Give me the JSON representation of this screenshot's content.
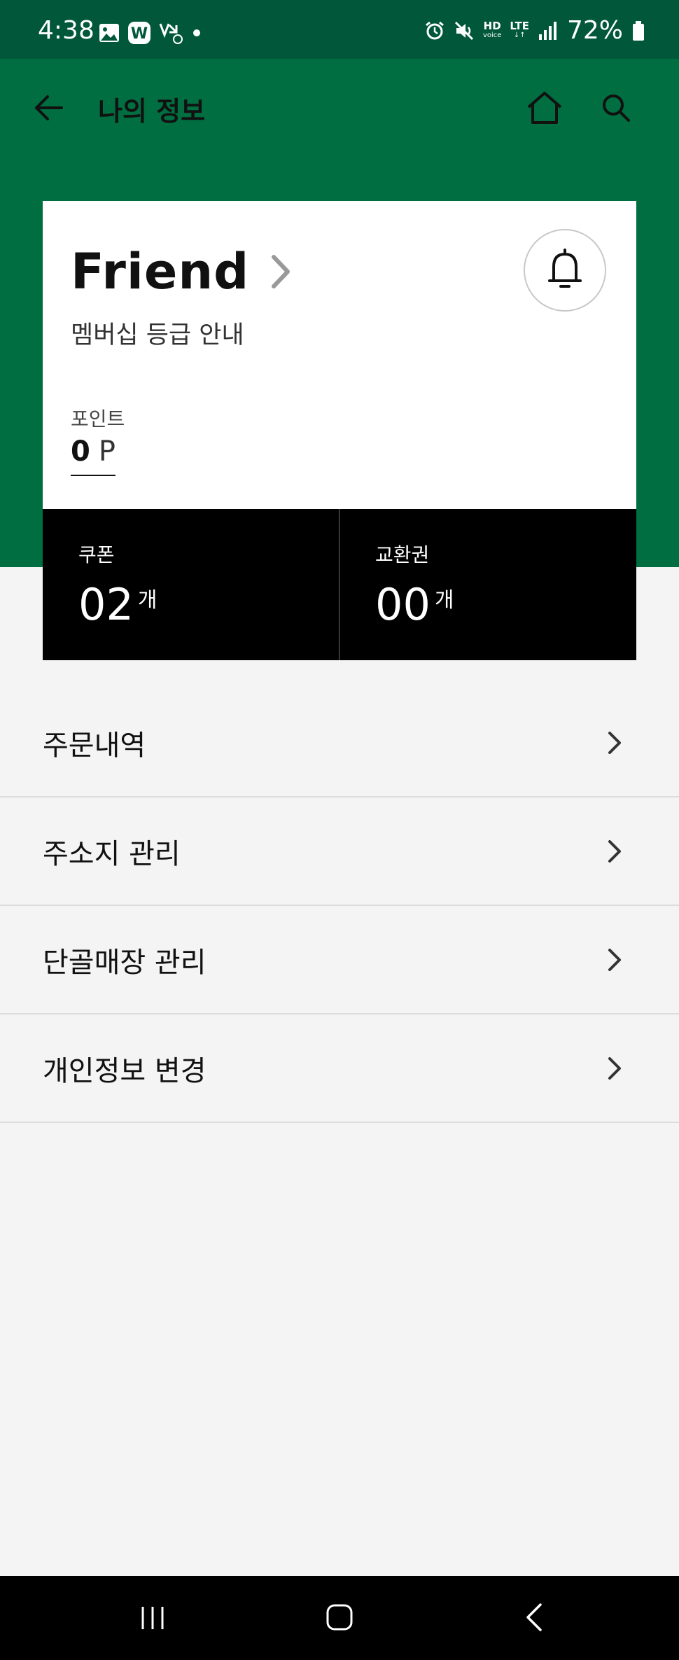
{
  "status_bar": {
    "time": "4:38",
    "battery": "72%",
    "hd_label": "HD",
    "hd_sub": "voice",
    "lte_label": "LTE"
  },
  "app_bar": {
    "title": "나의 정보"
  },
  "membership": {
    "tier": "Friend",
    "guide_label": "멤버십 등급 안내",
    "points_label": "포인트",
    "points_value": "0",
    "points_unit": "P"
  },
  "stats": {
    "coupon_label": "쿠폰",
    "coupon_value": "02",
    "coupon_unit": "개",
    "voucher_label": "교환권",
    "voucher_value": "00",
    "voucher_unit": "개"
  },
  "menu": {
    "items": [
      {
        "label": "주문내역"
      },
      {
        "label": "주소지 관리"
      },
      {
        "label": "단골매장 관리"
      },
      {
        "label": "개인정보 변경"
      }
    ]
  },
  "colors": {
    "brand_green": "#006e40",
    "status_green": "#00573a",
    "background": "#f4f4f4"
  },
  "icons": {
    "back": "arrow-left-icon",
    "home": "home-icon",
    "search": "search-icon",
    "bell": "bell-icon",
    "chevron": "chevron-right-icon"
  }
}
